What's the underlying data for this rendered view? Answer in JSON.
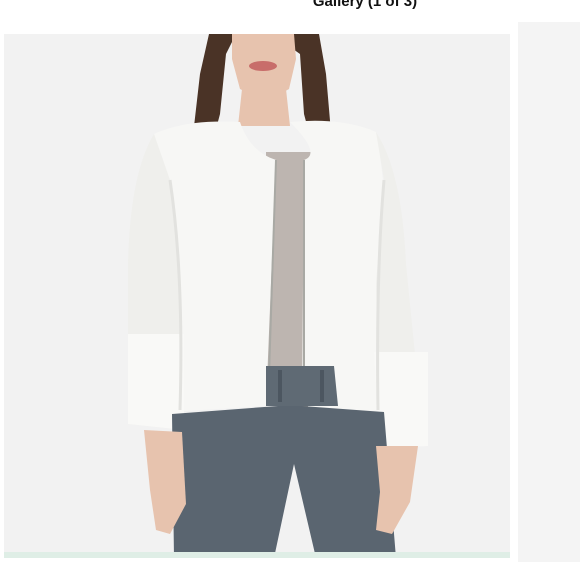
{
  "gallery": {
    "caption": "Gallery (1 of 3)"
  },
  "photo": {
    "subject": "product-photo-white-jacket",
    "colors": {
      "background": "#f2f2f2",
      "jacket": "#f7f7f5",
      "jacket_shadow": "#e2e2df",
      "top": "#bdb5b0",
      "trousers": "#5a6570",
      "hair": "#4a3326",
      "skin": "#e7c3ae",
      "lips": "#c86d6a"
    }
  }
}
